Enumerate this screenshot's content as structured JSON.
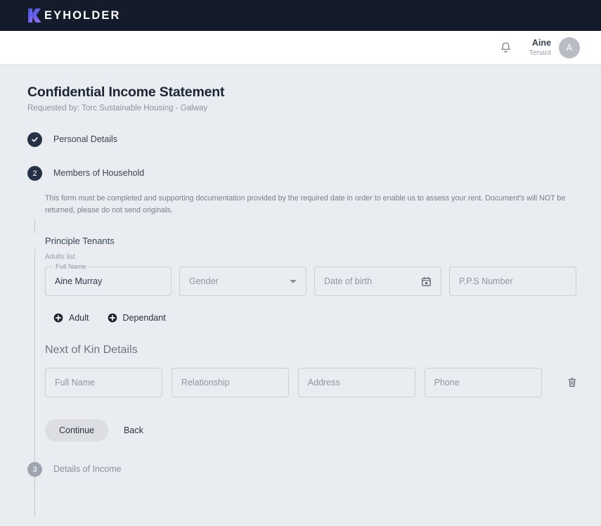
{
  "brand": {
    "logo_icon": "keyholder-k-logo",
    "name": "EYHOLDER"
  },
  "header": {
    "bell_icon": "bell-icon",
    "user": {
      "name": "Aine",
      "role": "Tenant",
      "avatar_initial": "A"
    }
  },
  "page": {
    "title": "Confidential Income Statement",
    "requested_by": "Requested by: Torc Sustainable Housing - Galway"
  },
  "steps": [
    {
      "number": "1",
      "label": "Personal Details",
      "state": "done",
      "marker": "check-icon"
    },
    {
      "number": "2",
      "label": "Members of Household",
      "state": "active",
      "marker": "2"
    },
    {
      "number": "3",
      "label": "Details of Income",
      "state": "idle",
      "marker": "3"
    }
  ],
  "household": {
    "notice": "This form must be completed and supporting documentation provided by the required date in order to enable us to assess your rent. Document's will NOT be returned, please do not send originals.",
    "principle_tenants_title": "Principle Tenants",
    "adults_list_label": "Adults list",
    "adult_row": {
      "full_name_label": "Full Name",
      "full_name_value": "Aine Murray",
      "gender_placeholder": "Gender",
      "gender_icon": "chevron-down-icon",
      "dob_placeholder": "Date of birth",
      "dob_icon": "calendar-icon",
      "pps_placeholder": "P.P.S Number"
    },
    "add_buttons": [
      {
        "label": "Adult",
        "icon": "plus-circle-icon"
      },
      {
        "label": "Dependant",
        "icon": "plus-circle-icon"
      }
    ]
  },
  "next_of_kin": {
    "title": "Next of Kin Details",
    "fields": [
      {
        "placeholder": "Full Name"
      },
      {
        "placeholder": "Relationship"
      },
      {
        "placeholder": "Address"
      },
      {
        "placeholder": "Phone"
      }
    ],
    "delete_icon": "trash-icon"
  },
  "actions": {
    "continue_label": "Continue",
    "back_label": "Back"
  },
  "colors": {
    "brandbar": "#141c2b",
    "page_bg": "#e9ecf1",
    "step_active": "#253145",
    "step_idle": "#9ea5b1",
    "logo_gradient_start": "#3b4fd8",
    "logo_gradient_end": "#8f6bf0"
  }
}
